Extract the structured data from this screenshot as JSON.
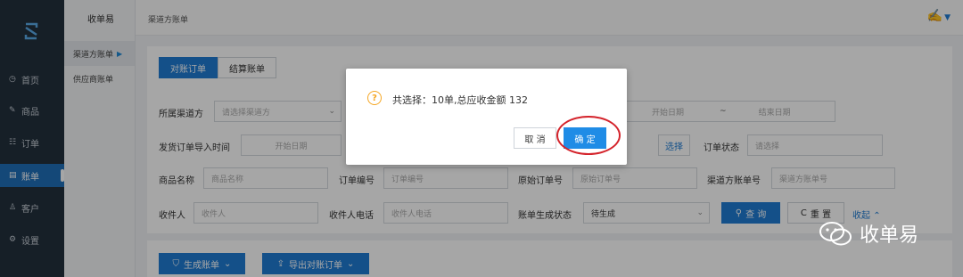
{
  "nav": {
    "items": [
      {
        "icon": "dashboard-icon",
        "glyph": "◷",
        "label": "首页"
      },
      {
        "icon": "edit-icon",
        "glyph": "✎",
        "label": "商品"
      },
      {
        "icon": "list-icon",
        "glyph": "☷",
        "label": "订单"
      },
      {
        "icon": "bill-icon",
        "glyph": "▤",
        "label": "账单"
      },
      {
        "icon": "user-icon",
        "glyph": "♙",
        "label": "客户"
      },
      {
        "icon": "settings-icon",
        "glyph": "⚙",
        "label": "设置"
      }
    ],
    "active_index": 3
  },
  "subnav": {
    "title": "收单易",
    "items": [
      {
        "label": "渠道方账单",
        "selected": true
      },
      {
        "label": "供应商账单",
        "selected": false
      }
    ]
  },
  "topbar": {
    "breadcrumb": "渠道方账单"
  },
  "tabs": [
    {
      "label": "对账订单",
      "active": true
    },
    {
      "label": "结算账单",
      "active": false
    }
  ],
  "filters": {
    "channel_label": "所属渠道方",
    "channel_placeholder": "请选择渠道方",
    "start_date": "开始日期",
    "date_sep": "~",
    "end_date": "结束日期",
    "import_time_label": "发货订单导入时间",
    "import_start": "开始日期",
    "select_btn": "选择",
    "order_status_label": "订单状态",
    "order_status_placeholder": "请选择",
    "product_label": "商品名称",
    "product_placeholder": "商品名称",
    "order_no_label": "订单编号",
    "order_no_placeholder": "订单编号",
    "origin_no_label": "原始订单号",
    "origin_no_placeholder": "原始订单号",
    "channel_order_label": "渠道方账单号",
    "channel_order_placeholder": "渠道方账单号",
    "receiver_label": "收件人",
    "receiver_placeholder": "收件人",
    "receiver_phone_label": "收件人电话",
    "receiver_phone_placeholder": "收件人电话",
    "bill_status_label": "账单生成状态",
    "bill_status_value": "待生成",
    "search_btn": "查 询",
    "reset_btn": "重 置",
    "collapse_link": "收起"
  },
  "actions": {
    "generate_btn": "生成账单",
    "export_btn": "导出对账订单"
  },
  "dialog": {
    "message": "共选择：10单,总应收金额 132",
    "cancel": "取 消",
    "ok": "确 定"
  },
  "watermark": {
    "text": "收单易"
  },
  "colors": {
    "primary": "#1f7cd3",
    "nav_bg": "#22303d",
    "highlight_ring": "#d4232b",
    "warning": "#f5a623"
  }
}
